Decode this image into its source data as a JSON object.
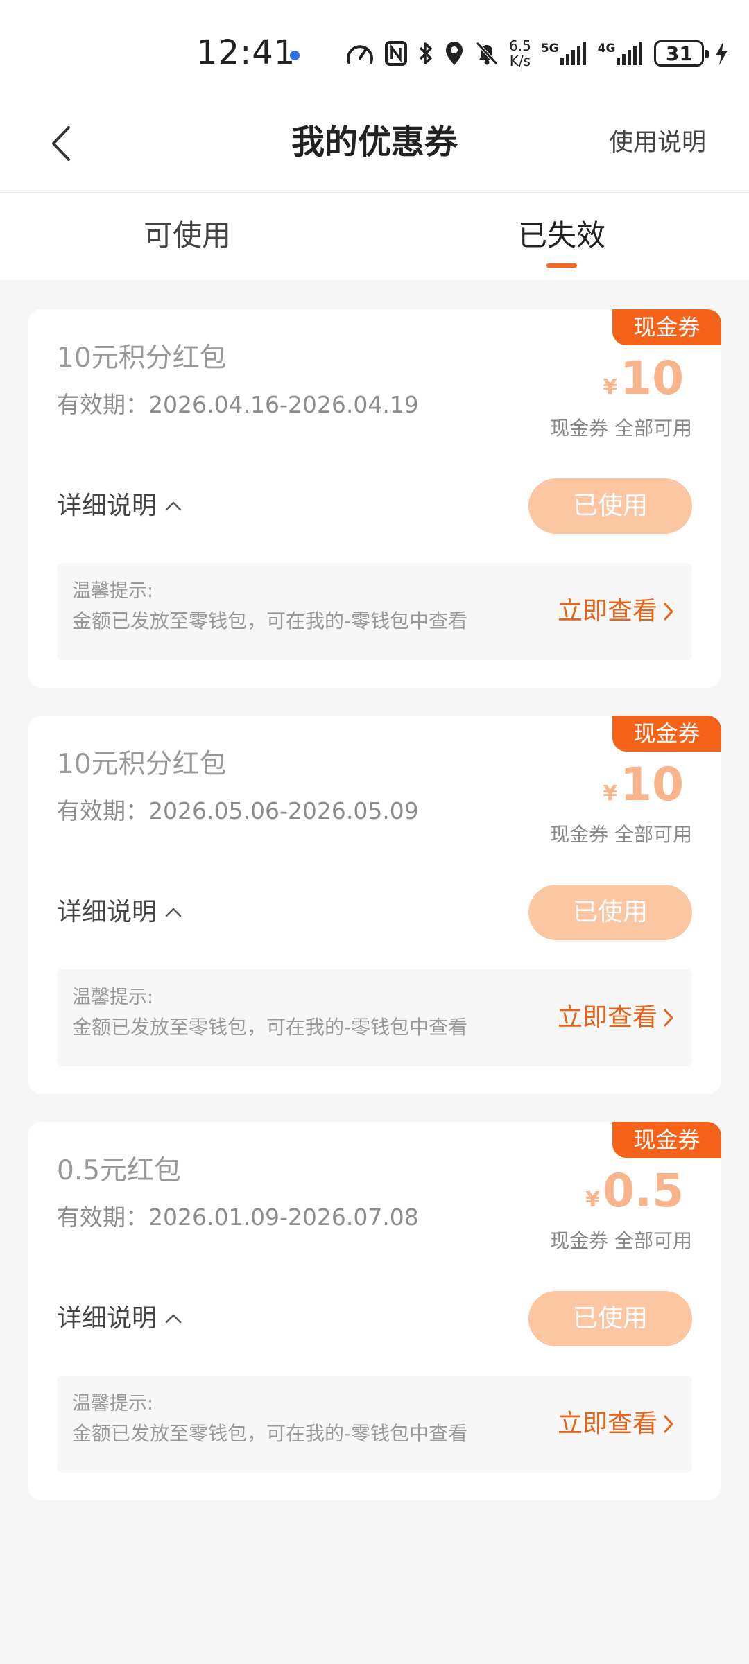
{
  "status_bar": {
    "time": "12:41",
    "net_speed_value": "6.5",
    "net_speed_unit": "K/s",
    "net_5g": "5G",
    "net_4g": "4G",
    "battery": "31"
  },
  "nav": {
    "title": "我的优惠券",
    "help_label": "使用说明"
  },
  "tabs": {
    "valid_label": "可使用",
    "expired_label": "已失效"
  },
  "coupons": [
    {
      "tag": "现金券",
      "name": "10元积分红包",
      "period": "有效期：2026.04.16-2026.04.19",
      "currency": "¥",
      "amount": "10",
      "sub": "现金券 全部可用",
      "detail_label": "详细说明",
      "status_label": "已使用",
      "tip_title": "温馨提示:",
      "tip_text": "金额已发放至零钱包，可在我的-零钱包中查看",
      "view_label": "立即查看"
    },
    {
      "tag": "现金券",
      "name": "10元积分红包",
      "period": "有效期：2026.05.06-2026.05.09",
      "currency": "¥",
      "amount": "10",
      "sub": "现金券 全部可用",
      "detail_label": "详细说明",
      "status_label": "已使用",
      "tip_title": "温馨提示:",
      "tip_text": "金额已发放至零钱包，可在我的-零钱包中查看",
      "view_label": "立即查看"
    },
    {
      "tag": "现金券",
      "name": "0.5元红包",
      "period": "有效期：2026.01.09-2026.07.08",
      "currency": "¥",
      "amount": "0.5",
      "sub": "现金券 全部可用",
      "detail_label": "详细说明",
      "status_label": "已使用",
      "tip_title": "温馨提示:",
      "tip_text": "金额已发放至零钱包，可在我的-零钱包中查看",
      "view_label": "立即查看"
    }
  ],
  "colors": {
    "accent": "#f5621a",
    "amount_faded": "#f9b48c",
    "used_button": "#fcc6a3"
  }
}
